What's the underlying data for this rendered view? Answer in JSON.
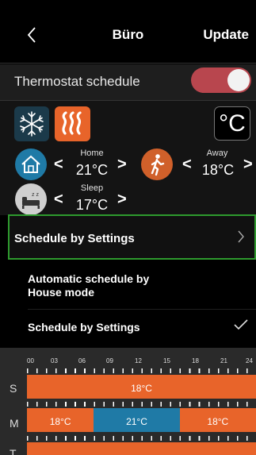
{
  "header": {
    "title": "Büro",
    "update_label": "Update"
  },
  "toggle_row": {
    "label": "Thermostat schedule",
    "enabled": true
  },
  "colors": {
    "heat_accent": "#E8642A",
    "cool_accent": "#1F7AA6",
    "toggle_on": "#B8464E",
    "selection_outline": "#2E9A2E"
  },
  "modes": {
    "unit": "°C",
    "home": {
      "label": "Home",
      "temp": "21°C"
    },
    "away": {
      "label": "Away",
      "temp": "18°C"
    },
    "sleep": {
      "label": "Sleep",
      "temp": "17°C"
    },
    "arrow_left": "<",
    "arrow_right": ">"
  },
  "schedule_row": {
    "label": "Schedule by Settings"
  },
  "options": [
    {
      "label": "Automatic schedule by House mode",
      "selected": false
    },
    {
      "label": "Schedule by Settings",
      "selected": true
    }
  ],
  "timeline": {
    "hours": [
      "00",
      "03",
      "06",
      "09",
      "12",
      "15",
      "18",
      "21",
      "24"
    ],
    "days": [
      {
        "day": "S",
        "segments": [
          {
            "temp": "18°C",
            "mode": "away",
            "start": 0,
            "end": 24
          }
        ]
      },
      {
        "day": "M",
        "segments": [
          {
            "temp": "18°C",
            "mode": "away",
            "start": 0,
            "end": 7
          },
          {
            "temp": "21°C",
            "mode": "home",
            "start": 7,
            "end": 16
          },
          {
            "temp": "18°C",
            "mode": "away",
            "start": 16,
            "end": 24
          }
        ]
      },
      {
        "day": "T",
        "segments": [
          {
            "temp": "",
            "mode": "away",
            "start": 0,
            "end": 24
          }
        ]
      }
    ]
  }
}
